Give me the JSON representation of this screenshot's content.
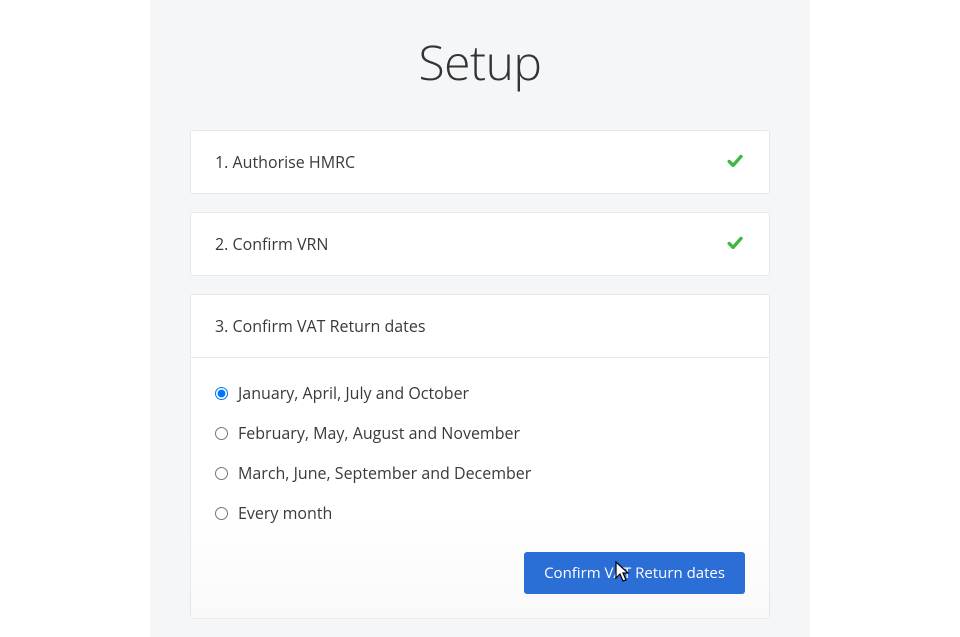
{
  "page": {
    "title": "Setup"
  },
  "steps": {
    "step1": {
      "title": "1. Authorise HMRC",
      "completed": true
    },
    "step2": {
      "title": "2. Confirm VRN",
      "completed": true
    },
    "step3": {
      "title": "3. Confirm VAT Return dates",
      "options": [
        {
          "label": "January, April, July and October",
          "selected": true
        },
        {
          "label": "February, May, August and November",
          "selected": false
        },
        {
          "label": "March, June, September and December",
          "selected": false
        },
        {
          "label": "Every month",
          "selected": false
        }
      ],
      "confirm_button": "Confirm VAT Return dates"
    }
  },
  "colors": {
    "accent": "#2b6fd6",
    "success": "#3fb83f"
  }
}
